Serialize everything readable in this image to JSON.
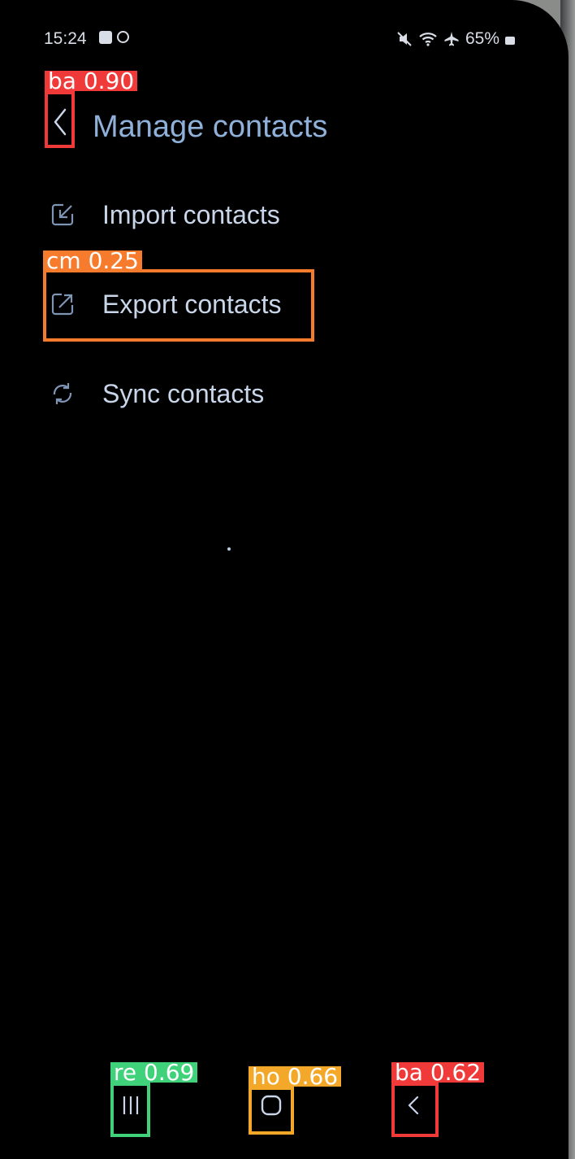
{
  "status_bar": {
    "time": "15:24",
    "left_icons": [
      "checkbox-notification-icon",
      "circle-notification-icon"
    ],
    "right_icons": [
      "mute-icon",
      "wifi-icon",
      "airplane-icon",
      "battery-icon"
    ],
    "battery_percent": "65%"
  },
  "header": {
    "title": "Manage contacts",
    "back_icon": "chevron-left-icon"
  },
  "menu": {
    "items": [
      {
        "label": "Import contacts",
        "icon": "import-icon"
      },
      {
        "label": "Export contacts",
        "icon": "export-icon"
      },
      {
        "label": "Sync contacts",
        "icon": "sync-icon"
      }
    ]
  },
  "nav_bar": {
    "recent_icon": "recents-icon",
    "home_icon": "home-icon",
    "back_icon": "back-icon"
  },
  "detections": [
    {
      "label": "ba 0.90",
      "color": "#f03a3a"
    },
    {
      "label": "cm 0.25",
      "color": "#f77b2c"
    },
    {
      "label": "re 0.69",
      "color": "#3fd27a"
    },
    {
      "label": "ho 0.66",
      "color": "#f4a82a"
    },
    {
      "label": "ba 0.62",
      "color": "#f03a3a"
    }
  ],
  "colors": {
    "title": "#8fb0d8",
    "item_text": "#c9d6ea",
    "background": "#000000"
  }
}
